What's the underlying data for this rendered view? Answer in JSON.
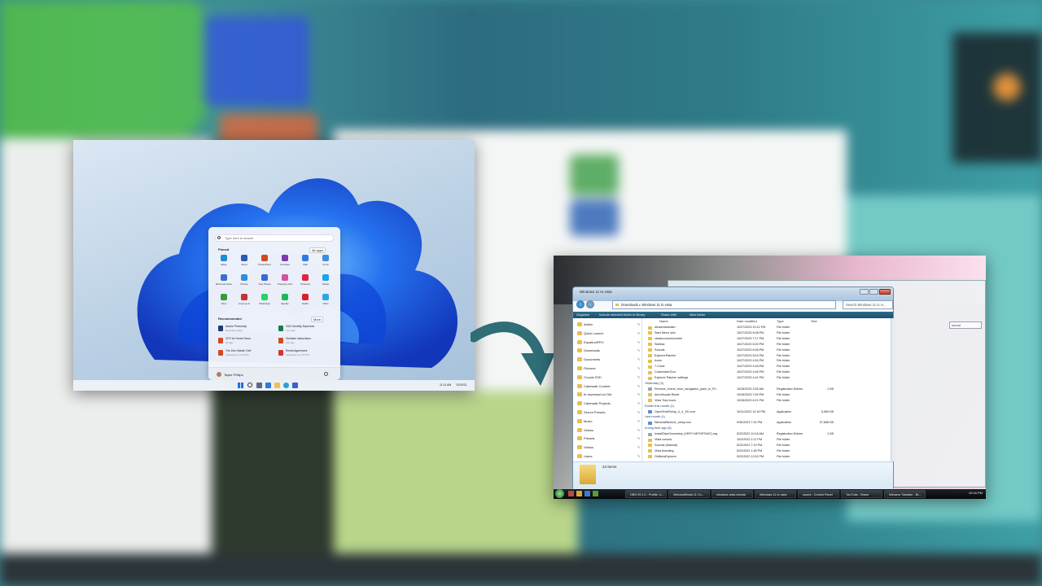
{
  "colors": {
    "accent": "#2f6d77",
    "win11_blue": "#0d5fe0",
    "vista_bar": "#1e4f6c"
  },
  "win11": {
    "search_placeholder": "Type here to search",
    "pinned_label": "Pinned",
    "all_apps_label": "All apps",
    "pinned_apps": [
      {
        "label": "Edge",
        "color": "#1f8ad8"
      },
      {
        "label": "Word",
        "color": "#2b5bb5"
      },
      {
        "label": "PowerPoint",
        "color": "#d24726"
      },
      {
        "label": "OneNote",
        "color": "#7d3bb1"
      },
      {
        "label": "Mail",
        "color": "#2f7ae6"
      },
      {
        "label": "To Do",
        "color": "#3e8de2"
      },
      {
        "label": "Microsoft Store",
        "color": "#3a6fcf"
      },
      {
        "label": "Photos",
        "color": "#2e8fd8"
      },
      {
        "label": "Your Phone",
        "color": "#3b68d2"
      },
      {
        "label": "Snipping Tool",
        "color": "#d1539a"
      },
      {
        "label": "Pinterest",
        "color": "#e1243b"
      },
      {
        "label": "Twitter",
        "color": "#1da1f2"
      },
      {
        "label": "Xbox",
        "color": "#3a9a3a"
      },
      {
        "label": "Among Us",
        "color": "#c33535"
      },
      {
        "label": "WhatsApp",
        "color": "#25d366"
      },
      {
        "label": "Spotify",
        "color": "#1db954"
      },
      {
        "label": "Netflix",
        "color": "#d81f26"
      },
      {
        "label": "Paint",
        "color": "#2ca6e6"
      }
    ],
    "recommended_label": "Recommended",
    "more_label": "More",
    "recommended": [
      {
        "title": "Adobe Photoshop",
        "sub": "Recently added",
        "color": "#1f3d6b"
      },
      {
        "title": "2021 Monthly Expenses",
        "sub": "17m ago",
        "color": "#1d7a44"
      },
      {
        "title": "CFO for Home Decor",
        "sub": "2h ago",
        "color": "#d04a26"
      },
      {
        "title": "Christine Instructions",
        "sub": "12h ago",
        "color": "#d04a26"
      },
      {
        "title": "The Zero Waste Chef",
        "sub": "Yesterday at 4:24 PM",
        "color": "#d04a26"
      },
      {
        "title": "Rental Agreement",
        "sub": "Yesterday at 1:15 PM",
        "color": "#d43636"
      }
    ],
    "user_name": "Taylor Philips",
    "time": "11:11 AM",
    "date": "10/20/21"
  },
  "vista": {
    "window_title": "Windows 11 to vista",
    "address": [
      "Downloads",
      "Windows 11 to vista"
    ],
    "search_placeholder": "Search Windows 11 to vi...",
    "command_bar": [
      "Organize",
      "Include selected folder in library",
      "Share with",
      "New folder"
    ],
    "nav_items": [
      {
        "label": "Admin",
        "pinned": true
      },
      {
        "label": "Quick Launch",
        "pinned": true
      },
      {
        "label": "EquationRPO",
        "pinned": true
      },
      {
        "label": "Downloads",
        "pinned": true
      },
      {
        "label": "Documents",
        "pinned": true
      },
      {
        "label": "Pictures",
        "pinned": true
      },
      {
        "label": "Crucial SSD",
        "pinned": true
      },
      {
        "label": "Cakewalk Content",
        "pinned": true
      },
      {
        "label": "fe download cd Old",
        "pinned": true
      },
      {
        "label": "Cakewalk Projects",
        "pinned": true
      },
      {
        "label": "Serum Presets",
        "pinned": true
      },
      {
        "label": "Music",
        "pinned": true
      },
      {
        "label": "Videos",
        "pinned": true
      },
      {
        "label": "Presets",
        "pinned": true
      },
      {
        "label": "Videos",
        "pinned": true
      },
      {
        "label": "Users",
        "pinned": true
      }
    ],
    "columns": [
      "Name",
      "Date modified",
      "Type",
      "Size"
    ],
    "rows": [
      {
        "kind": "file",
        "name": "winaerotweaker",
        "date": "10/27/2023 10:12 PM",
        "type": "File folder",
        "size": ""
      },
      {
        "kind": "file",
        "name": "Start Menu skin",
        "date": "10/27/2023 6:08 PM",
        "type": "File folder",
        "size": ""
      },
      {
        "kind": "file",
        "name": "classiccolumncontrol",
        "date": "10/27/2023 7:17 PM",
        "type": "File folder",
        "size": ""
      },
      {
        "kind": "file",
        "name": "Sidebar",
        "date": "10/27/2023 6:20 PM",
        "type": "File folder",
        "size": ""
      },
      {
        "kind": "file",
        "name": "Sounds",
        "date": "10/27/2023 6:06 PM",
        "type": "File folder",
        "size": ""
      },
      {
        "kind": "file",
        "name": "ExplorerPatcher",
        "date": "10/27/2023 5:04 PM",
        "type": "File folder",
        "size": ""
      },
      {
        "kind": "file",
        "name": "Icons",
        "date": "10/27/2023 4:54 PM",
        "type": "File folder",
        "size": ""
      },
      {
        "kind": "file",
        "name": "7-Clock",
        "date": "10/27/2023 4:48 PM",
        "type": "File folder",
        "size": ""
      },
      {
        "kind": "file",
        "name": "CustomizerGod",
        "date": "10/27/2023 4:46 PM",
        "type": "File folder",
        "size": ""
      },
      {
        "kind": "file",
        "name": "Explorer Patcher settings",
        "date": "10/27/2023 4:41 PM",
        "type": "File folder",
        "size": ""
      },
      {
        "kind": "group",
        "name": "Yesterday (3)"
      },
      {
        "kind": "file",
        "name": "Remove_Home_from_navigation_pane_in_Fil...",
        "date": "10/26/2023 3:55 AM",
        "type": "Registration Entries",
        "size": "1 KB"
      },
      {
        "kind": "file",
        "name": "AeroVisuals Reset",
        "date": "10/26/2023 7:50 PM",
        "type": "File folder",
        "size": ""
      },
      {
        "kind": "file",
        "name": "Vista Tray Icons",
        "date": "10/26/2023 6:21 PM",
        "type": "File folder",
        "size": ""
      },
      {
        "kind": "group",
        "name": "Earlier this month (1)"
      },
      {
        "kind": "file",
        "name": "OpenShellSetup_4_4_191.exe",
        "date": "10/11/2023 12:16 PM",
        "type": "Application",
        "size": "6,069 KB"
      },
      {
        "kind": "group",
        "name": "Last month (1)"
      },
      {
        "kind": "file",
        "name": "WindowBlinds11_setup.exe",
        "date": "9/30/2023 7:24 PM",
        "type": "Application",
        "size": "97,858 KB"
      },
      {
        "kind": "group",
        "name": "A long time ago (5)"
      },
      {
        "kind": "file",
        "name": "InstallTakeOwnership (VERY IMPORTANT).reg",
        "date": "5/22/2022 10:18 AM",
        "type": "Registration Entries",
        "size": "1 KB"
      },
      {
        "kind": "file",
        "name": "Vista cursors",
        "date": "10/2/2022 2:11 PM",
        "type": "File folder",
        "size": ""
      },
      {
        "kind": "file",
        "name": "Sounds (Manual)",
        "date": "5/22/2022 7:19 PM",
        "type": "File folder",
        "size": ""
      },
      {
        "kind": "file",
        "name": "Vista branding",
        "date": "5/22/2022 1:28 PM",
        "type": "File folder",
        "size": ""
      },
      {
        "kind": "file",
        "name": "OldNewExplorer",
        "date": "5/22/2022 12:52 PM",
        "type": "File folder",
        "size": ""
      }
    ],
    "item_count": "24 items",
    "taskbar_items": [
      "OBS 29.1.0 - Profile: U...",
      "WindowBlinds 11 Co...",
      "windows vista tutorial",
      "Windows 11 to vista",
      "sound - Control Panel",
      "YouTube - Brave",
      "Winaero Tweaker - Br..."
    ],
    "clock": "10:16 PM",
    "bg_search": "sound"
  }
}
